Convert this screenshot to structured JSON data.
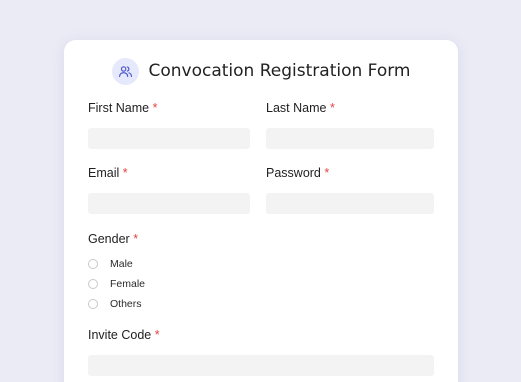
{
  "form": {
    "title": "Convocation Registration Form",
    "icon": "users-icon",
    "required_marker": "*",
    "fields": {
      "first_name": {
        "label": "First Name",
        "value": ""
      },
      "last_name": {
        "label": "Last Name",
        "value": ""
      },
      "email": {
        "label": "Email",
        "value": ""
      },
      "password": {
        "label": "Password",
        "value": ""
      },
      "invite_code": {
        "label": "Invite Code",
        "value": ""
      }
    },
    "gender": {
      "label": "Gender",
      "options": [
        "Male",
        "Female",
        "Others"
      ]
    }
  },
  "colors": {
    "background": "#ebebf6",
    "card": "#ffffff",
    "input_bg": "#f3f3f3",
    "required": "#e04545",
    "icon_bg": "#e6e8fb",
    "icon_stroke": "#4a55c9"
  }
}
